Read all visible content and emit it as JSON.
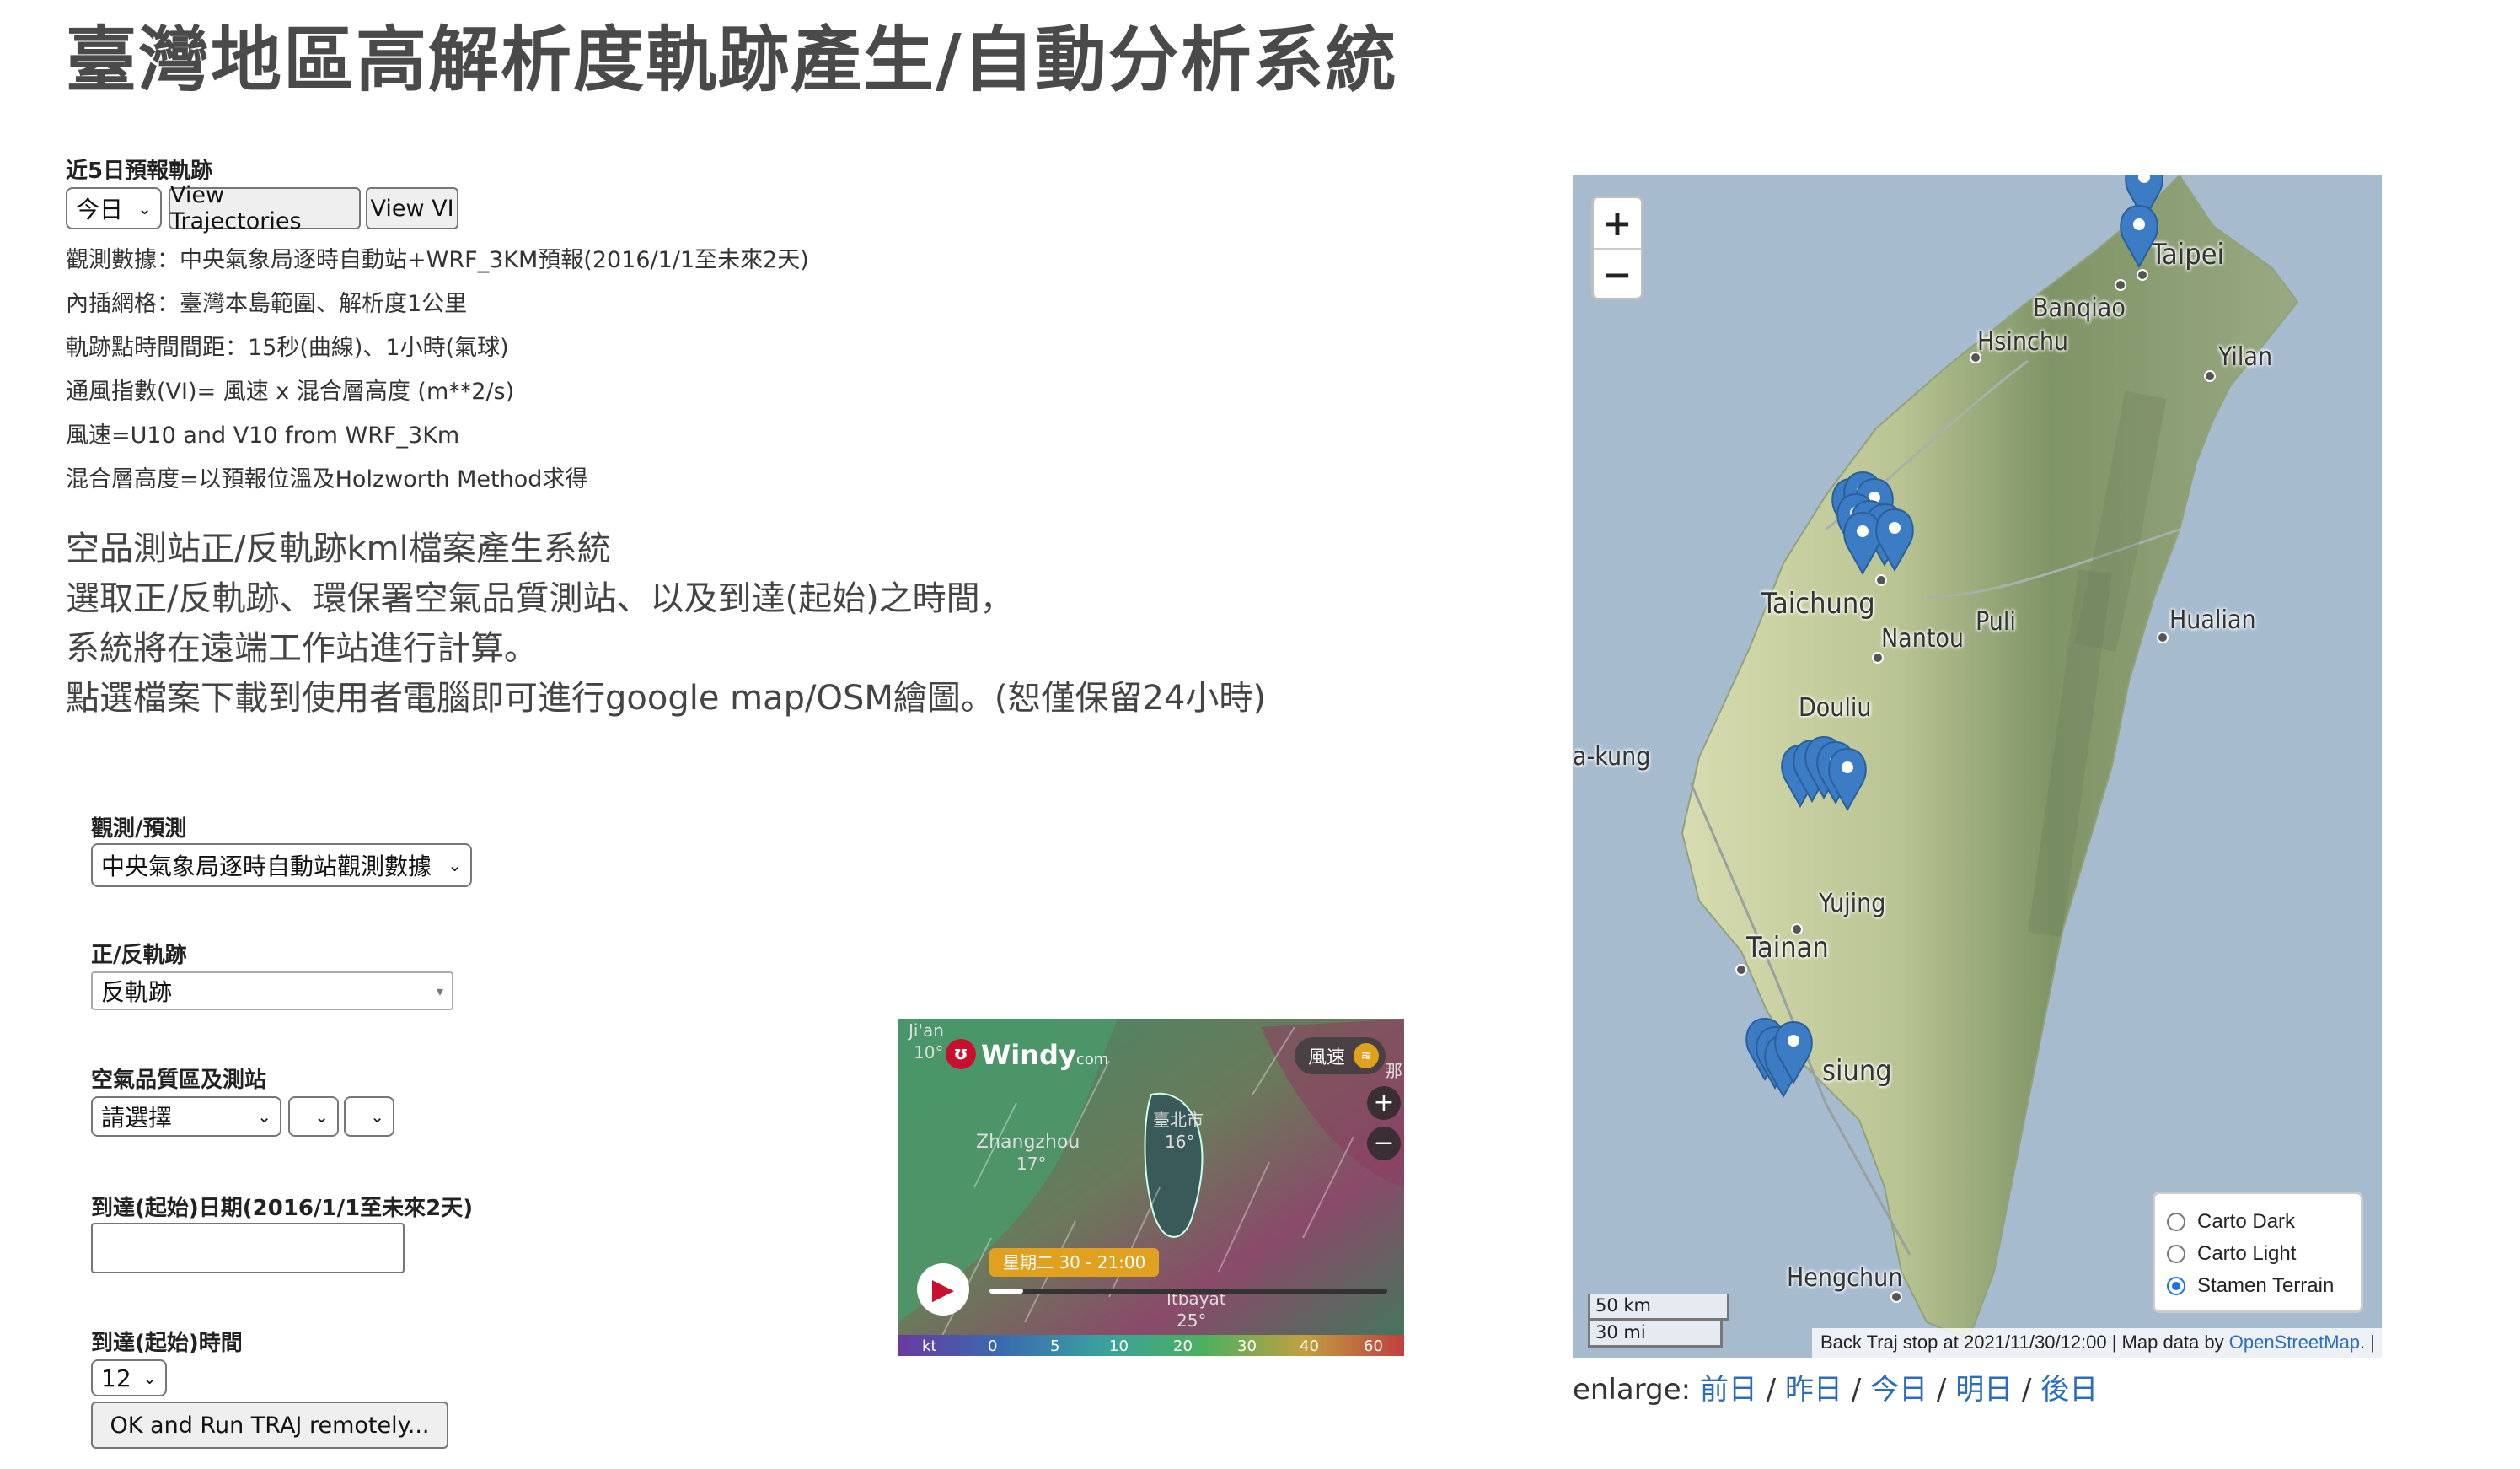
{
  "title": "臺灣地區高解析度軌跡產生/自動分析系統",
  "forecast": {
    "heading": "近5日預報軌跡",
    "day_select": "今日",
    "view_traj_label": "View Trajectories",
    "view_vi_label": "View VI",
    "info_lines": [
      "觀測數據：中央氣象局逐時自動站+WRF_3KM預報(2016/1/1至未來2天)",
      "內插網格：臺灣本島範圍、解析度1公里",
      "軌跡點時間間距：15秒(曲線)、1小時(氣球)",
      "通風指數(VI)= 風速 x 混合層高度 (m**2/s)",
      "風速=U10 and V10 from WRF_3Km",
      "混合層高度=以預報位溫及Holzworth Method求得"
    ]
  },
  "kml": {
    "lines": [
      "空品測站正/反軌跡kml檔案產生系統",
      "選取正/反軌跡、環保署空氣品質測站、以及到達(起始)之時間，",
      "系統將在遠端工作站進行計算。",
      "點選檔案下載到使用者電腦即可進行google map/OSM繪圖。(恕僅保留24小時)"
    ]
  },
  "form": {
    "obs_label": "觀測/預測",
    "obs_value": "中央氣象局逐時自動站觀測數據",
    "dir_label": "正/反軌跡",
    "dir_value": "反軌跡",
    "station_label": "空氣品質區及測站",
    "station_value": "請選擇",
    "date_label": "到達(起始)日期(2016/1/1至未來2天)",
    "date_value": "",
    "time_label": "到達(起始)時間",
    "time_value": "12",
    "run_label": "OK and Run TRAJ remotely..."
  },
  "windy": {
    "brand": "Windy",
    "brand_suffix": "com",
    "layer_label": "風速",
    "time_label": "星期二 30 - 21:00",
    "place_labels": [
      "Ji'an",
      "10°",
      "Zhangzhou",
      "17°",
      "臺北市",
      "16°",
      "Itbayat",
      "25°",
      "那"
    ],
    "scale_unit": "kt",
    "scale_values": [
      "0",
      "5",
      "10",
      "20",
      "30",
      "40",
      "60"
    ]
  },
  "map": {
    "zoom_in": "+",
    "zoom_out": "−",
    "cities": [
      "Taipei",
      "Banqiao",
      "Hsinchu",
      "Yilan",
      "Taichung",
      "Puli",
      "Nantou",
      "Hualian",
      "Douliu",
      "a-kung",
      "Yujing",
      "Tainan",
      "siung",
      "Hengchun"
    ],
    "layers": [
      {
        "label": "Carto Dark",
        "selected": false
      },
      {
        "label": "Carto Light",
        "selected": false
      },
      {
        "label": "Stamen Terrain",
        "selected": true
      }
    ],
    "scale_km": "50 km",
    "scale_mi": "30 mi",
    "attribution_text": "Back Traj stop at 2021/11/30/12:00 | Map data by ",
    "attribution_link": "OpenStreetMap",
    "attribution_end": ". |"
  },
  "enlarge": {
    "label": "enlarge:",
    "links": [
      "前日",
      "昨日",
      "今日",
      "明日",
      "後日"
    ],
    "sep": "/"
  },
  "colors": {
    "marker": "#3b7cc4",
    "link": "#2a6dc0",
    "map_water": "#a7bbcf",
    "land": "#c9d3a5"
  }
}
